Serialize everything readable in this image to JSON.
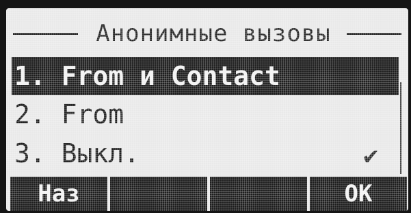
{
  "screen": {
    "title": "Анонимные вызовы"
  },
  "menu": {
    "items": [
      {
        "label": "1. From и Contact",
        "selected": true,
        "checked": false
      },
      {
        "label": "2. From",
        "selected": false,
        "checked": false
      },
      {
        "label": "3. Выкл.",
        "selected": false,
        "checked": true
      }
    ],
    "check_glyph": "✔"
  },
  "softkeys": {
    "back_label": "Наз",
    "empty_2": "",
    "empty_3": "",
    "ok_label": "OK"
  },
  "icons": {
    "check": "checkmark-icon"
  },
  "colors": {
    "lcd_background": "#e9e9e9",
    "lcd_foreground": "#1e1e1e",
    "bezel": "#151515"
  }
}
